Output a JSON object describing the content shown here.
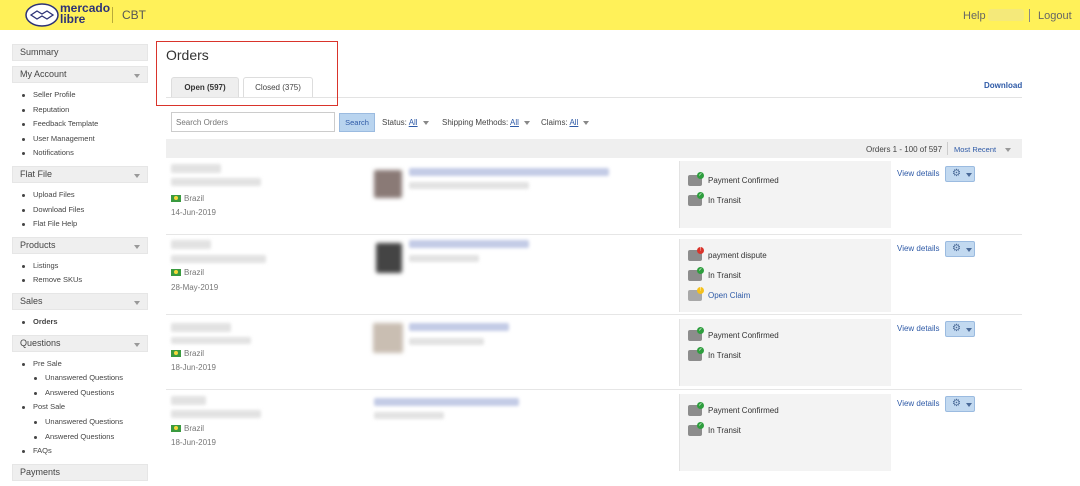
{
  "header": {
    "brand_line1": "mercado",
    "brand_line2": "libre",
    "section": "CBT",
    "help": "Help",
    "logout": "Logout"
  },
  "sidebar": {
    "summary": "Summary",
    "my_account": {
      "label": "My Account",
      "items": [
        "Seller Profile",
        "Reputation",
        "Feedback Template",
        "User Management",
        "Notifications"
      ]
    },
    "flat_file": {
      "label": "Flat File",
      "items": [
        "Upload Files",
        "Download Files",
        "Flat File Help"
      ]
    },
    "products": {
      "label": "Products",
      "items": [
        "Listings",
        "Remove SKUs"
      ]
    },
    "sales": {
      "label": "Sales",
      "items": [
        "Orders"
      ]
    },
    "questions": {
      "label": "Questions",
      "pre_sale": "Pre Sale",
      "pre_sale_items": [
        "Unanswered Questions",
        "Answered Questions"
      ],
      "post_sale": "Post Sale",
      "post_sale_items": [
        "Unanswered Questions",
        "Answered Questions"
      ],
      "faqs": "FAQs"
    },
    "payments": "Payments"
  },
  "main": {
    "title": "Orders",
    "tabs": [
      {
        "label": "Open (597)"
      },
      {
        "label": "Closed (375)"
      }
    ],
    "download": "Download",
    "search": {
      "placeholder": "Search Orders",
      "button": "Search"
    },
    "filters": {
      "status_label": "Status:",
      "status_value": "All",
      "shipping_label": "Shipping Methods:",
      "shipping_value": "All",
      "claims_label": "Claims:",
      "claims_value": "All"
    },
    "pager": {
      "count": "Orders 1 - 100 of 597",
      "sort": "Most Recent"
    },
    "view_details": "View details",
    "orders": [
      {
        "country": "Brazil",
        "date": "14-Jun-2019",
        "statuses": [
          {
            "text": "Payment Confirmed"
          },
          {
            "text": "In Transit"
          }
        ]
      },
      {
        "country": "Brazil",
        "date": "28-May-2019",
        "statuses": [
          {
            "text": "payment dispute"
          },
          {
            "text": "In Transit"
          },
          {
            "text": "Open Claim"
          }
        ]
      },
      {
        "country": "Brazil",
        "date": "18-Jun-2019",
        "statuses": [
          {
            "text": "Payment Confirmed"
          },
          {
            "text": "In Transit"
          }
        ]
      },
      {
        "country": "Brazil",
        "date": "18-Jun-2019",
        "statuses": [
          {
            "text": "Payment Confirmed"
          },
          {
            "text": "In Transit"
          }
        ]
      }
    ]
  },
  "colors": {
    "header_bg": "#fff159",
    "link": "#2e5aa7",
    "highlight_box": "#d9342b",
    "ok_badge": "#2e9e3e",
    "alert_badge": "#d9342b",
    "claim_badge": "#f4c01c"
  }
}
